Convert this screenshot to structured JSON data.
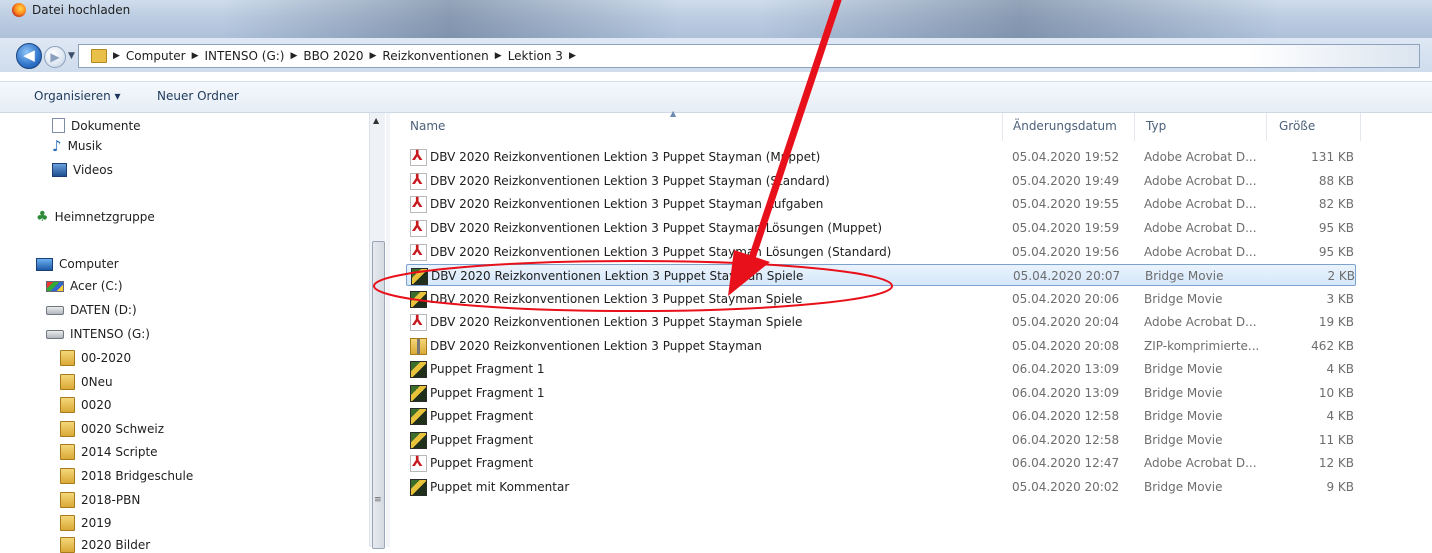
{
  "window": {
    "title": "Datei hochladen"
  },
  "address": {
    "crumbs": [
      "Computer",
      "INTENSO (G:)",
      "BBO 2020",
      "Reizkonventionen",
      "Lektion 3"
    ]
  },
  "toolbar": {
    "organize_label": "Organisieren ▾",
    "new_folder_label": "Neuer Ordner"
  },
  "sidebar": {
    "items": [
      {
        "label": "Dokumente",
        "icon": "documents-icon"
      },
      {
        "label": "Musik",
        "icon": "music-icon"
      },
      {
        "label": "Videos",
        "icon": "videos-icon"
      },
      {
        "label": "Heimnetzgruppe",
        "icon": "homegroup-icon"
      },
      {
        "label": "Computer",
        "icon": "computer-icon"
      },
      {
        "label": "Acer (C:)",
        "icon": "windows-drive-icon"
      },
      {
        "label": "DATEN (D:)",
        "icon": "drive-icon"
      },
      {
        "label": "INTENSO (G:)",
        "icon": "drive-icon"
      },
      {
        "label": "00-2020",
        "icon": "folder-icon"
      },
      {
        "label": "0Neu",
        "icon": "folder-icon"
      },
      {
        "label": "0020",
        "icon": "folder-icon"
      },
      {
        "label": "0020 Schweiz",
        "icon": "folder-icon"
      },
      {
        "label": "2014 Scripte",
        "icon": "folder-icon"
      },
      {
        "label": "2018 Bridgeschule",
        "icon": "folder-icon"
      },
      {
        "label": "2018-PBN",
        "icon": "folder-icon"
      },
      {
        "label": "2019",
        "icon": "folder-icon"
      },
      {
        "label": "2020 Bilder",
        "icon": "folder-icon"
      }
    ]
  },
  "columns": {
    "name": "Name",
    "date": "Änderungsdatum",
    "type": "Typ",
    "size": "Größe"
  },
  "files": [
    {
      "name": "DBV 2020 Reizkonventionen Lektion 3 Puppet Stayman (Muppet)",
      "date": "05.04.2020 19:52",
      "type": "Adobe Acrobat D...",
      "size": "131 KB",
      "icon": "pdf-icon"
    },
    {
      "name": "DBV 2020 Reizkonventionen Lektion 3 Puppet Stayman (Standard)",
      "date": "05.04.2020 19:49",
      "type": "Adobe Acrobat D...",
      "size": "88 KB",
      "icon": "pdf-icon"
    },
    {
      "name": "DBV 2020 Reizkonventionen Lektion 3 Puppet Stayman Aufgaben",
      "date": "05.04.2020 19:55",
      "type": "Adobe Acrobat D...",
      "size": "82 KB",
      "icon": "pdf-icon"
    },
    {
      "name": "DBV 2020 Reizkonventionen Lektion 3 Puppet Stayman Lösungen (Muppet)",
      "date": "05.04.2020 19:59",
      "type": "Adobe Acrobat D...",
      "size": "95 KB",
      "icon": "pdf-icon"
    },
    {
      "name": "DBV 2020 Reizkonventionen Lektion 3 Puppet Stayman Lösungen (Standard)",
      "date": "05.04.2020 19:56",
      "type": "Adobe Acrobat D...",
      "size": "95 KB",
      "icon": "pdf-icon"
    },
    {
      "name": "DBV 2020 Reizkonventionen Lektion 3 Puppet Stayman Spiele",
      "date": "05.04.2020 20:07",
      "type": "Bridge Movie",
      "size": "2 KB",
      "icon": "bridge-movie-icon",
      "selected": true
    },
    {
      "name": "DBV 2020 Reizkonventionen Lektion 3 Puppet Stayman Spiele",
      "date": "05.04.2020 20:06",
      "type": "Bridge Movie",
      "size": "3 KB",
      "icon": "bridge-movie-icon"
    },
    {
      "name": "DBV 2020 Reizkonventionen Lektion 3 Puppet Stayman Spiele",
      "date": "05.04.2020 20:04",
      "type": "Adobe Acrobat D...",
      "size": "19 KB",
      "icon": "pdf-icon"
    },
    {
      "name": "DBV 2020 Reizkonventionen Lektion 3 Puppet Stayman",
      "date": "05.04.2020 20:08",
      "type": "ZIP-komprimierte...",
      "size": "462 KB",
      "icon": "zip-icon"
    },
    {
      "name": "Puppet Fragment 1",
      "date": "06.04.2020 13:09",
      "type": "Bridge Movie",
      "size": "4 KB",
      "icon": "bridge-movie-icon"
    },
    {
      "name": "Puppet Fragment 1",
      "date": "06.04.2020 13:09",
      "type": "Bridge Movie",
      "size": "10 KB",
      "icon": "bridge-movie-icon"
    },
    {
      "name": "Puppet Fragment",
      "date": "06.04.2020 12:58",
      "type": "Bridge Movie",
      "size": "4 KB",
      "icon": "bridge-movie-icon"
    },
    {
      "name": "Puppet Fragment",
      "date": "06.04.2020 12:58",
      "type": "Bridge Movie",
      "size": "11 KB",
      "icon": "bridge-movie-icon"
    },
    {
      "name": "Puppet Fragment",
      "date": "06.04.2020 12:47",
      "type": "Adobe Acrobat D...",
      "size": "12 KB",
      "icon": "pdf-icon"
    },
    {
      "name": "Puppet mit Kommentar",
      "date": "05.04.2020 20:02",
      "type": "Bridge Movie",
      "size": "9 KB",
      "icon": "bridge-movie-icon"
    }
  ],
  "colors": {
    "selection": "#d6e8fb",
    "selection_border": "#7da2ce",
    "annotation": "#e8101a"
  }
}
